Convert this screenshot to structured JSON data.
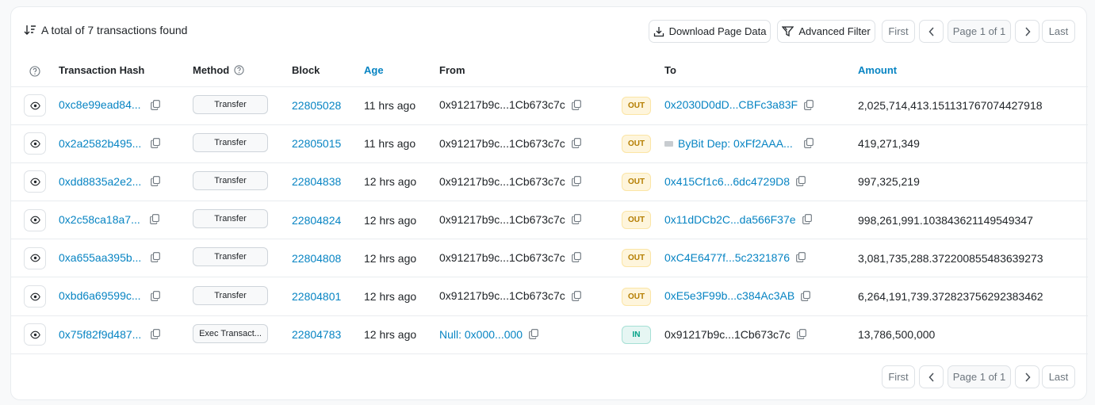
{
  "summary": "A total of 7 transactions found",
  "toolbar": {
    "download_label": "Download Page Data",
    "filter_label": "Advanced Filter"
  },
  "pagination": {
    "first": "First",
    "page": "Page 1 of 1",
    "last": "Last"
  },
  "columns": {
    "hash": "Transaction Hash",
    "method": "Method",
    "block": "Block",
    "age": "Age",
    "from": "From",
    "to": "To",
    "amount": "Amount"
  },
  "colors": {
    "link": "#0784c3",
    "out": "#b47d00",
    "in": "#00a186"
  },
  "rows": [
    {
      "hash": "0xc8e99ead84...",
      "method": "Transfer",
      "block": "22805028",
      "age": "11 hrs ago",
      "from": "0x91217b9c...1Cb673c7c",
      "from_link": false,
      "direction": "OUT",
      "to": "0x2030D0dD...CBFc3a83F",
      "to_link": true,
      "to_icon": false,
      "amount": "2,025,714,413.151131767074427918"
    },
    {
      "hash": "0x2a2582b495...",
      "method": "Transfer",
      "block": "22805015",
      "age": "11 hrs ago",
      "from": "0x91217b9c...1Cb673c7c",
      "from_link": false,
      "direction": "OUT",
      "to": "ByBit Dep: 0xFf2AAA...",
      "to_link": true,
      "to_icon": true,
      "amount": "419,271,349"
    },
    {
      "hash": "0xdd8835a2e2...",
      "method": "Transfer",
      "block": "22804838",
      "age": "12 hrs ago",
      "from": "0x91217b9c...1Cb673c7c",
      "from_link": false,
      "direction": "OUT",
      "to": "0x415Cf1c6...6dc4729D8",
      "to_link": true,
      "to_icon": false,
      "amount": "997,325,219"
    },
    {
      "hash": "0x2c58ca18a7...",
      "method": "Transfer",
      "block": "22804824",
      "age": "12 hrs ago",
      "from": "0x91217b9c...1Cb673c7c",
      "from_link": false,
      "direction": "OUT",
      "to": "0x11dDCb2C...da566F37e",
      "to_link": true,
      "to_icon": false,
      "amount": "998,261,991.103843621149549347"
    },
    {
      "hash": "0xa655aa395b...",
      "method": "Transfer",
      "block": "22804808",
      "age": "12 hrs ago",
      "from": "0x91217b9c...1Cb673c7c",
      "from_link": false,
      "direction": "OUT",
      "to": "0xC4E6477f...5c2321876",
      "to_link": true,
      "to_icon": false,
      "amount": "3,081,735,288.372200855483639273"
    },
    {
      "hash": "0xbd6a69599c...",
      "method": "Transfer",
      "block": "22804801",
      "age": "12 hrs ago",
      "from": "0x91217b9c...1Cb673c7c",
      "from_link": false,
      "direction": "OUT",
      "to": "0xE5e3F99b...c384Ac3AB",
      "to_link": true,
      "to_icon": false,
      "amount": "6,264,191,739.372823756292383462"
    },
    {
      "hash": "0x75f82f9d487...",
      "method": "Exec Transact...",
      "block": "22804783",
      "age": "12 hrs ago",
      "from": "Null: 0x000...000",
      "from_link": true,
      "direction": "IN",
      "to": "0x91217b9c...1Cb673c7c",
      "to_link": false,
      "to_icon": false,
      "amount": "13,786,500,000"
    }
  ]
}
